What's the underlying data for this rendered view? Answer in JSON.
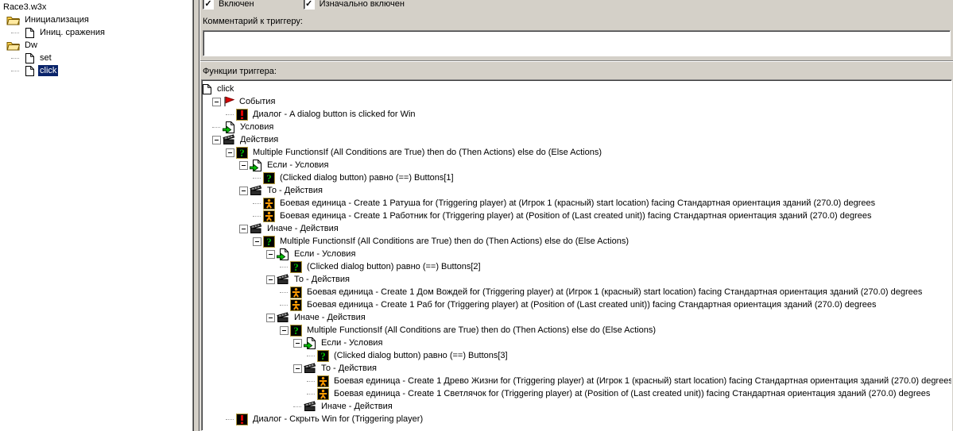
{
  "colors": {
    "selection_bg": "#0a246a",
    "panel_bg": "#d4d0c8",
    "icon_frame": "#b49b3c",
    "event_red": "#dd0000",
    "condition_green": "#00c000",
    "unit_orange": "#ff9c00"
  },
  "left_panel": {
    "items": [
      {
        "label": "Race3.w3x",
        "icon": null,
        "level": 0,
        "expander": false,
        "selected": false
      },
      {
        "label": "Инициализация",
        "icon": "folder",
        "level": 1,
        "expander": false,
        "selected": false
      },
      {
        "label": "Иниц. сражения",
        "icon": "page",
        "level": 2,
        "expander": false,
        "selected": false
      },
      {
        "label": "Dw",
        "icon": "folder",
        "level": 1,
        "expander": false,
        "selected": false
      },
      {
        "label": "set",
        "icon": "page",
        "level": 2,
        "expander": false,
        "selected": false
      },
      {
        "label": "click",
        "icon": "page",
        "level": 2,
        "expander": false,
        "selected": true
      }
    ]
  },
  "right_panel": {
    "enabled": {
      "label": "Включен",
      "checked": true,
      "checkmark": "✓"
    },
    "initially_on": {
      "label": "Изначально включен",
      "checked": true,
      "checkmark": "✓"
    },
    "comment_label": "Комментарий к триггеру:",
    "comment_value": "",
    "functions_label": "Функции триггера:",
    "tree": [
      {
        "label": "click",
        "icon": "page",
        "level": 0,
        "expander": false
      },
      {
        "label": "События",
        "icon": "flag",
        "level": 1,
        "expander": true
      },
      {
        "label": "Диалог - A dialog button is clicked for Win",
        "icon": "dialog",
        "level": 2,
        "expander": false
      },
      {
        "label": "Условия",
        "icon": "conditions",
        "level": 1,
        "expander": false
      },
      {
        "label": "Действия",
        "icon": "actions",
        "level": 1,
        "expander": true
      },
      {
        "label": "Multiple FunctionsIf (All Conditions are True) then do (Then Actions) else do (Else Actions)",
        "icon": "question",
        "level": 2,
        "expander": true
      },
      {
        "label": "Если - Условия",
        "icon": "conditions",
        "level": 3,
        "expander": true
      },
      {
        "label": "(Clicked dialog button) равно (==) Buttons[1]",
        "icon": "question",
        "level": 4,
        "expander": false
      },
      {
        "label": "То - Действия",
        "icon": "actions",
        "level": 3,
        "expander": true
      },
      {
        "label": "Боевая единица - Create 1 Ратуша for (Triggering player) at (Игрок 1 (красный) start location) facing Стандартная ориентация зданий (270.0) degrees",
        "icon": "unit",
        "level": 4,
        "expander": false
      },
      {
        "label": "Боевая единица - Create 1 Работник for (Triggering player) at (Position of (Last created unit)) facing Стандартная ориентация зданий (270.0) degrees",
        "icon": "unit",
        "level": 4,
        "expander": false
      },
      {
        "label": "Иначе - Действия",
        "icon": "actions",
        "level": 3,
        "expander": true
      },
      {
        "label": "Multiple FunctionsIf (All Conditions are True) then do (Then Actions) else do (Else Actions)",
        "icon": "question",
        "level": 4,
        "expander": true
      },
      {
        "label": "Если - Условия",
        "icon": "conditions",
        "level": 5,
        "expander": true
      },
      {
        "label": "(Clicked dialog button) равно (==) Buttons[2]",
        "icon": "question",
        "level": 6,
        "expander": false
      },
      {
        "label": "То - Действия",
        "icon": "actions",
        "level": 5,
        "expander": true
      },
      {
        "label": "Боевая единица - Create 1 Дом Вождей for (Triggering player) at (Игрок 1 (красный) start location) facing Стандартная ориентация зданий (270.0) degrees",
        "icon": "unit",
        "level": 6,
        "expander": false
      },
      {
        "label": "Боевая единица - Create 1 Раб for (Triggering player) at (Position of (Last created unit)) facing Стандартная ориентация зданий (270.0) degrees",
        "icon": "unit",
        "level": 6,
        "expander": false
      },
      {
        "label": "Иначе - Действия",
        "icon": "actions",
        "level": 5,
        "expander": true
      },
      {
        "label": "Multiple FunctionsIf (All Conditions are True) then do (Then Actions) else do (Else Actions)",
        "icon": "question",
        "level": 6,
        "expander": true
      },
      {
        "label": "Если - Условия",
        "icon": "conditions",
        "level": 7,
        "expander": true
      },
      {
        "label": "(Clicked dialog button) равно (==) Buttons[3]",
        "icon": "question",
        "level": 8,
        "expander": false
      },
      {
        "label": "То - Действия",
        "icon": "actions",
        "level": 7,
        "expander": true
      },
      {
        "label": "Боевая единица - Create 1 Древо Жизни for (Triggering player) at (Игрок 1 (красный) start location) facing Стандартная ориентация зданий (270.0) degrees",
        "icon": "unit",
        "level": 8,
        "expander": false
      },
      {
        "label": "Боевая единица - Create 1 Светлячок for (Triggering player) at (Position of (Last created unit)) facing Стандартная ориентация зданий (270.0) degrees",
        "icon": "unit",
        "level": 8,
        "expander": false
      },
      {
        "label": "Иначе - Действия",
        "icon": "actions",
        "level": 7,
        "expander": false
      },
      {
        "label": "Диалог - Скрыть Win for (Triggering player)",
        "icon": "dialog",
        "level": 2,
        "expander": false
      }
    ]
  }
}
